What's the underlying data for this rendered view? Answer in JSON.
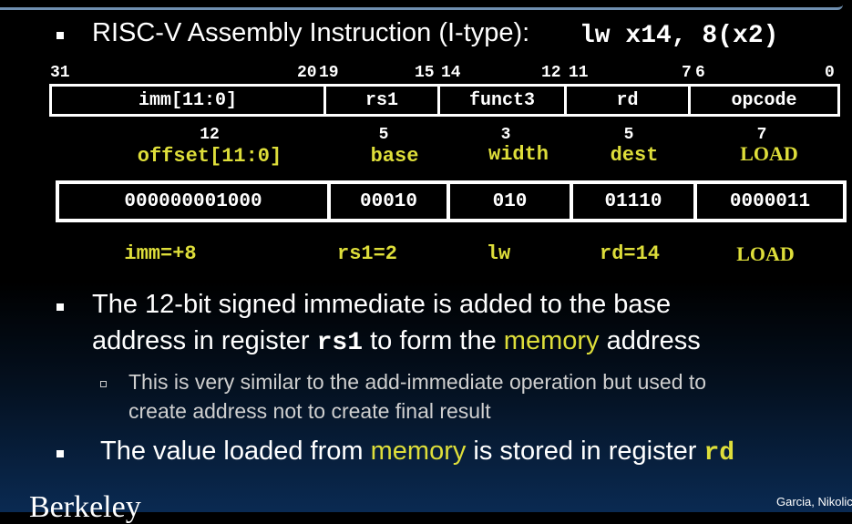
{
  "title": {
    "text": "RISC-V Assembly Instruction (I-type):",
    "code": "lw x14, 8(x2)"
  },
  "bit_positions": [
    "31",
    "20",
    "19",
    "15",
    "14",
    "12",
    "11",
    "7",
    "6",
    "0"
  ],
  "format_fields": [
    "imm[11:0]",
    "rs1",
    "funct3",
    "rd",
    "opcode"
  ],
  "widths": [
    "12",
    "5",
    "3",
    "5",
    "7"
  ],
  "field_meanings": [
    "offset[11:0]",
    "base",
    "width",
    "dest",
    "LOAD"
  ],
  "encoding": [
    "000000001000",
    "00010",
    "010",
    "01110",
    "0000011"
  ],
  "decoded": [
    "imm=+8",
    "rs1=2",
    "lw",
    "rd=14",
    "LOAD"
  ],
  "bullets": {
    "b1_part1": "The 12-bit signed immediate is added to the base",
    "b1_part2": "address in register",
    "b1_code": "rs1",
    "b1_part3": "to form the",
    "b1_highlight": "memory",
    "b1_part4": "address",
    "sub1_line1": "This is very similar to the add-immediate operation but used to",
    "sub1_line2": "create address not to create final result",
    "b2_part1": "The value loaded from",
    "b2_highlight": "memory",
    "b2_part2": "is stored in register",
    "b2_code": "rd"
  },
  "footer": {
    "credit": "Garcia, Nikolic",
    "logo_text": "Berkeley"
  },
  "colors": {
    "highlight": "#dede3a",
    "text": "#ffffff"
  }
}
